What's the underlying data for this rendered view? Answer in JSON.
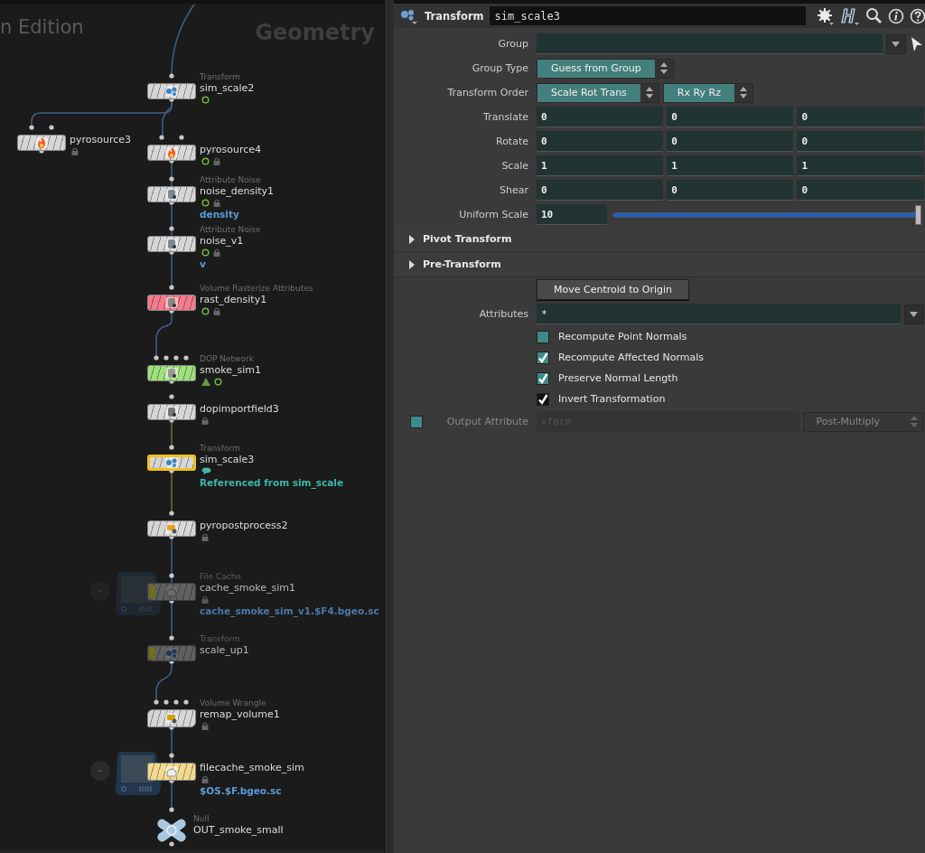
{
  "network": {
    "watermark": "n Edition",
    "context": "Geometry",
    "nodes": [
      {
        "type": "Transform",
        "name": "sim_scale2",
        "kind": "transform",
        "time_dependent": true,
        "locked": false,
        "selected": false,
        "bypassed": false
      },
      {
        "name": "pyrosource3",
        "kind": "fire",
        "time_dependent": false,
        "locked": true,
        "selected": false,
        "bypassed": false
      },
      {
        "name": "pyrosource4",
        "kind": "fire",
        "time_dependent": true,
        "locked": true,
        "selected": false,
        "bypassed": false
      },
      {
        "type": "Attribute Noise",
        "name": "noise_density1",
        "kind": "noise",
        "time_dependent": true,
        "locked": true,
        "selected": false,
        "bypassed": false,
        "note": {
          "text": "density",
          "color": "#5b9bd8"
        }
      },
      {
        "type": "Attribute Noise",
        "name": "noise_v1",
        "kind": "noise",
        "time_dependent": true,
        "locked": true,
        "selected": false,
        "bypassed": false,
        "note": {
          "text": "v",
          "color": "#5b9bd8"
        }
      },
      {
        "type": "Volume Rasterize Attributes",
        "name": "rast_density1",
        "kind": "volume",
        "color": "#f27b8c",
        "time_dependent": true,
        "locked": true,
        "selected": false,
        "bypassed": false
      },
      {
        "type": "DOP Network",
        "name": "smoke_sim1",
        "kind": "network",
        "color": "#9ee07c",
        "time_dependent": true,
        "locked": false,
        "simulation": true,
        "selected": false,
        "bypassed": false
      },
      {
        "name": "dopimportfield3",
        "kind": "import",
        "time_dependent": false,
        "locked": true,
        "selected": false,
        "bypassed": false
      },
      {
        "type": "Transform",
        "name": "sim_scale3",
        "kind": "transform",
        "time_dependent": false,
        "locked": false,
        "comment": true,
        "selected": true,
        "bypassed": false,
        "note": {
          "text": "Referenced from sim_scale",
          "color": "#3fb5a9"
        }
      },
      {
        "name": "pyropostprocess2",
        "kind": "post",
        "time_dependent": false,
        "locked": true,
        "selected": false,
        "bypassed": false
      },
      {
        "type": "File Cache",
        "name": "cache_smoke_sim1",
        "kind": "filecache",
        "time_dependent": false,
        "locked": true,
        "selected": false,
        "bypassed": true,
        "note": {
          "text": "cache_smoke_sim_v1.$F4.bgeo.sc",
          "color": "#4a78a6"
        }
      },
      {
        "type": "Transform",
        "name": "scale_up1",
        "kind": "transform",
        "time_dependent": false,
        "locked": false,
        "selected": false,
        "bypassed": true
      },
      {
        "type": "Volume Wrangle",
        "name": "remap_volume1",
        "kind": "wrangle",
        "time_dependent": false,
        "locked": true,
        "selected": false,
        "bypassed": false
      },
      {
        "name": "filecache_smoke_sim",
        "kind": "filecache",
        "color": "#f2d98e",
        "time_dependent": false,
        "locked": true,
        "selected": false,
        "bypassed": false,
        "note": {
          "text": "$OS.$F.bgeo.sc",
          "color": "#5b9bd8"
        }
      },
      {
        "type": "Null",
        "name": "OUT_smoke_small",
        "kind": "null",
        "time_dependent": false,
        "locked": false,
        "selected": false,
        "bypassed": false
      }
    ]
  },
  "parameters": {
    "node_type": "Transform",
    "node_name": "sim_scale3",
    "rows": [
      {
        "kind": "menu_field",
        "label": "Group",
        "picker": true
      },
      {
        "kind": "menu",
        "label": "Group Type",
        "menus": [
          "Guess from Group"
        ]
      },
      {
        "kind": "menu",
        "label": "Transform Order",
        "menus": [
          "Scale Rot Trans",
          "Rx Ry Rz"
        ]
      },
      {
        "kind": "vector",
        "label": "Translate",
        "values": [
          "0",
          "0",
          "0"
        ]
      },
      {
        "kind": "vector",
        "label": "Rotate",
        "values": [
          "0",
          "0",
          "0"
        ]
      },
      {
        "kind": "vector",
        "label": "Scale",
        "values": [
          "1",
          "1",
          "1"
        ]
      },
      {
        "kind": "vector",
        "label": "Shear",
        "values": [
          "0",
          "0",
          "0"
        ]
      },
      {
        "kind": "slider",
        "label": "Uniform Scale",
        "value": "10",
        "level": 1
      },
      {
        "kind": "folder",
        "label": "Pivot Transform",
        "expanded": false
      },
      {
        "kind": "folder",
        "label": "Pre-Transform",
        "expanded": false
      },
      {
        "kind": "button",
        "label": "Move Centroid to Origin"
      },
      {
        "kind": "menu_field",
        "label": "Attributes",
        "value": "*",
        "picker": false
      },
      {
        "kind": "checkbox",
        "label": "Recompute Point Normals",
        "checked": false,
        "modified": false
      },
      {
        "kind": "checkbox",
        "label": "Recompute Affected Normals",
        "checked": true,
        "modified": false
      },
      {
        "kind": "checkbox",
        "label": "Preserve Normal Length",
        "checked": true,
        "modified": false
      },
      {
        "kind": "checkbox",
        "label": "Invert Transformation",
        "checked": true,
        "modified": true
      },
      {
        "kind": "toggle_field",
        "label": "Output Attribute",
        "enabled": false,
        "value": "xform",
        "menu": "Post-Multiply"
      }
    ]
  }
}
